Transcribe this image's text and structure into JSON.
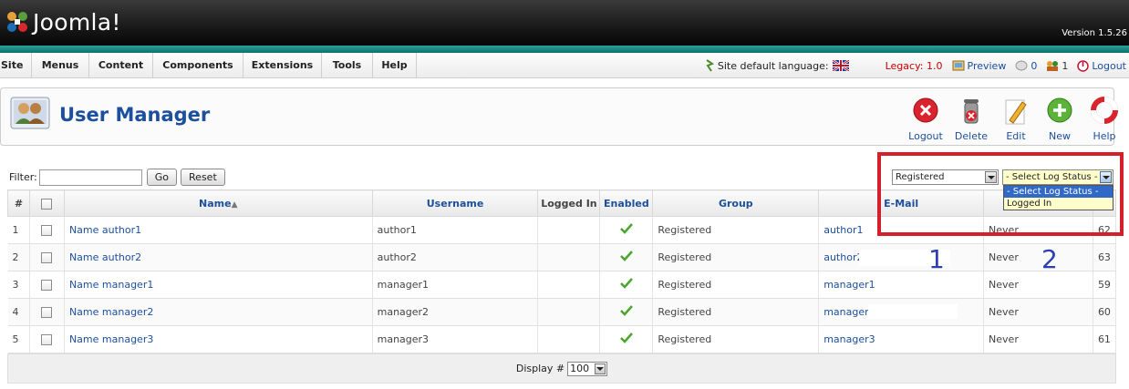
{
  "header": {
    "logo_text": "Joomla!",
    "version": "Version 1.5.26"
  },
  "menu": {
    "items": [
      {
        "label": "Site",
        "name": "menu-site"
      },
      {
        "label": "Menus",
        "name": "menu-menus"
      },
      {
        "label": "Content",
        "name": "menu-content"
      },
      {
        "label": "Components",
        "name": "menu-components"
      },
      {
        "label": "Extensions",
        "name": "menu-extensions"
      },
      {
        "label": "Tools",
        "name": "menu-tools"
      },
      {
        "label": "Help",
        "name": "menu-help"
      }
    ]
  },
  "status": {
    "language_label": "Site default language:",
    "legacy": "Legacy: 1.0",
    "preview": "Preview",
    "messages_count": "0",
    "users_count": "1",
    "logout": "Logout"
  },
  "toolbar": {
    "title": "User Manager",
    "buttons": {
      "logout": "Logout",
      "delete": "Delete",
      "edit": "Edit",
      "new": "New",
      "help": "Help"
    }
  },
  "filter": {
    "label": "Filter:",
    "value": "",
    "go": "Go",
    "reset": "Reset",
    "group_select": "Registered",
    "log_status_select": "- Select Log Status -",
    "log_status_options": [
      "- Select Log Status -",
      "Logged In"
    ]
  },
  "table": {
    "headers": {
      "num": "#",
      "name": "Name",
      "sort_arrow": "▲",
      "username": "Username",
      "logged_in": "Logged In",
      "enabled": "Enabled",
      "group": "Group",
      "email": "E-Mail"
    },
    "rows": [
      {
        "num": "1",
        "name": "Name author1",
        "username": "author1",
        "group": "Registered",
        "email": "author1",
        "last_visit": "Never",
        "id": "62"
      },
      {
        "num": "2",
        "name": "Name author2",
        "username": "author2",
        "group": "Registered",
        "email": "author2",
        "last_visit": "Never",
        "id": "63"
      },
      {
        "num": "3",
        "name": "Name manager1",
        "username": "manager1",
        "group": "Registered",
        "email": "manager1",
        "last_visit": "Never",
        "id": "59"
      },
      {
        "num": "4",
        "name": "Name manager2",
        "username": "manager2",
        "group": "Registered",
        "email": "manager2",
        "last_visit": "Never",
        "id": "60"
      },
      {
        "num": "5",
        "name": "Name manager3",
        "username": "manager3",
        "group": "Registered",
        "email": "manager3",
        "last_visit": "Never",
        "id": "61"
      }
    ]
  },
  "pagination": {
    "display_label": "Display #",
    "display_value": "100"
  },
  "annotations": {
    "mark1": "1",
    "mark2": "2"
  }
}
